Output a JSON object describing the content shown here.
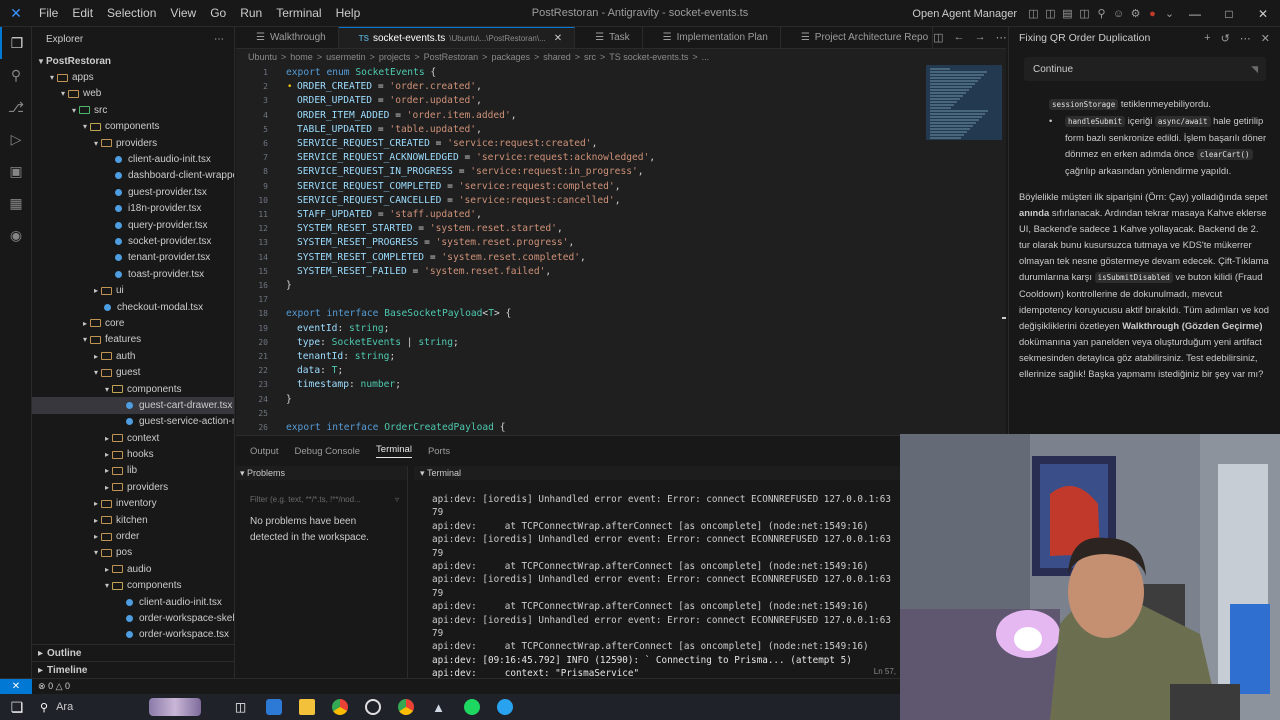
{
  "window": {
    "title": "PostRestoran - Antigravity - socket-events.ts",
    "menu": [
      "File",
      "Edit",
      "Selection",
      "View",
      "Go",
      "Run",
      "Terminal",
      "Help"
    ],
    "agent_manager": "Open Agent Manager"
  },
  "sidebar": {
    "title": "Explorer",
    "root": "PostRestoran",
    "tree": [
      {
        "label": "apps",
        "depth": 1,
        "type": "folder",
        "open": true
      },
      {
        "label": "web",
        "depth": 2,
        "type": "folder",
        "open": true
      },
      {
        "label": "src",
        "depth": 3,
        "type": "src",
        "open": true
      },
      {
        "label": "components",
        "depth": 4,
        "type": "comp",
        "open": true
      },
      {
        "label": "providers",
        "depth": 5,
        "type": "folder",
        "open": true
      },
      {
        "label": "client-audio-init.tsx",
        "depth": 6,
        "type": "file"
      },
      {
        "label": "dashboard-client-wrapper.tsx",
        "depth": 6,
        "type": "file"
      },
      {
        "label": "guest-provider.tsx",
        "depth": 6,
        "type": "file"
      },
      {
        "label": "i18n-provider.tsx",
        "depth": 6,
        "type": "file"
      },
      {
        "label": "query-provider.tsx",
        "depth": 6,
        "type": "file"
      },
      {
        "label": "socket-provider.tsx",
        "depth": 6,
        "type": "file"
      },
      {
        "label": "tenant-provider.tsx",
        "depth": 6,
        "type": "file"
      },
      {
        "label": "toast-provider.tsx",
        "depth": 6,
        "type": "file"
      },
      {
        "label": "ui",
        "depth": 5,
        "type": "folder",
        "open": false
      },
      {
        "label": "checkout-modal.tsx",
        "depth": 5,
        "type": "file"
      },
      {
        "label": "core",
        "depth": 4,
        "type": "folder",
        "open": false
      },
      {
        "label": "features",
        "depth": 4,
        "type": "folder",
        "open": true
      },
      {
        "label": "auth",
        "depth": 5,
        "type": "folder",
        "open": false
      },
      {
        "label": "guest",
        "depth": 5,
        "type": "folder",
        "open": true
      },
      {
        "label": "components",
        "depth": 6,
        "type": "comp",
        "open": true
      },
      {
        "label": "guest-cart-drawer.tsx",
        "depth": 7,
        "type": "file",
        "selected": true
      },
      {
        "label": "guest-service-action-menu.t...",
        "depth": 7,
        "type": "file"
      },
      {
        "label": "context",
        "depth": 6,
        "type": "folder",
        "open": false
      },
      {
        "label": "hooks",
        "depth": 6,
        "type": "folder",
        "open": false
      },
      {
        "label": "lib",
        "depth": 6,
        "type": "folder",
        "open": false
      },
      {
        "label": "providers",
        "depth": 6,
        "type": "folder",
        "open": false
      },
      {
        "label": "inventory",
        "depth": 5,
        "type": "folder",
        "open": false
      },
      {
        "label": "kitchen",
        "depth": 5,
        "type": "folder",
        "open": false
      },
      {
        "label": "order",
        "depth": 5,
        "type": "folder",
        "open": false
      },
      {
        "label": "pos",
        "depth": 5,
        "type": "folder",
        "open": true
      },
      {
        "label": "audio",
        "depth": 6,
        "type": "folder",
        "open": false
      },
      {
        "label": "components",
        "depth": 6,
        "type": "comp",
        "open": true
      },
      {
        "label": "client-audio-init.tsx",
        "depth": 7,
        "type": "file"
      },
      {
        "label": "order-workspace-skeleton.tsx",
        "depth": 7,
        "type": "file"
      },
      {
        "label": "order-workspace.tsx",
        "depth": 7,
        "type": "file"
      }
    ],
    "outline": "Outline",
    "timeline": "Timeline"
  },
  "tabs": [
    {
      "label": "Walkthrough",
      "active": false
    },
    {
      "label": "socket-events.ts",
      "path": "\\Ubuntu\\...\\PostRestoran\\...",
      "active": true
    },
    {
      "label": "Task",
      "active": false
    },
    {
      "label": "Implementation Plan",
      "active": false
    },
    {
      "label": "Project Architecture Repo",
      "active": false
    }
  ],
  "breadcrumb": [
    "Ubuntu",
    ">",
    "home",
    ">",
    "usermetin",
    ">",
    "projects",
    ">",
    "PostRestoran",
    ">",
    "packages",
    ">",
    "shared",
    ">",
    "src",
    ">",
    "TS socket-events.ts",
    ">",
    "..."
  ],
  "editor": {
    "lines": [
      [
        [
          "kw",
          "export "
        ],
        [
          "kw",
          "enum "
        ],
        [
          "ty",
          "SocketEvents "
        ],
        [
          "pn",
          "{"
        ]
      ],
      [
        [
          "en",
          "ORDER_CREATED"
        ],
        [
          "pn",
          " = "
        ],
        [
          "str",
          "'order.created'"
        ],
        [
          "pn",
          ","
        ]
      ],
      [
        [
          "en",
          "ORDER_UPDATED"
        ],
        [
          "pn",
          " = "
        ],
        [
          "str",
          "'order.updated'"
        ],
        [
          "pn",
          ","
        ]
      ],
      [
        [
          "en",
          "ORDER_ITEM_ADDED"
        ],
        [
          "pn",
          " = "
        ],
        [
          "str",
          "'order.item.added'"
        ],
        [
          "pn",
          ","
        ]
      ],
      [
        [
          "en",
          "TABLE_UPDATED"
        ],
        [
          "pn",
          " = "
        ],
        [
          "str",
          "'table.updated'"
        ],
        [
          "pn",
          ","
        ]
      ],
      [
        [
          "en",
          "SERVICE_REQUEST_CREATED"
        ],
        [
          "pn",
          " = "
        ],
        [
          "str",
          "'service:request:created'"
        ],
        [
          "pn",
          ","
        ]
      ],
      [
        [
          "en",
          "SERVICE_REQUEST_ACKNOWLEDGED"
        ],
        [
          "pn",
          " = "
        ],
        [
          "str",
          "'service:request:acknowledged'"
        ],
        [
          "pn",
          ","
        ]
      ],
      [
        [
          "en",
          "SERVICE_REQUEST_IN_PROGRESS"
        ],
        [
          "pn",
          " = "
        ],
        [
          "str",
          "'service:request:in_progress'"
        ],
        [
          "pn",
          ","
        ]
      ],
      [
        [
          "en",
          "SERVICE_REQUEST_COMPLETED"
        ],
        [
          "pn",
          " = "
        ],
        [
          "str",
          "'service:request:completed'"
        ],
        [
          "pn",
          ","
        ]
      ],
      [
        [
          "en",
          "SERVICE_REQUEST_CANCELLED"
        ],
        [
          "pn",
          " = "
        ],
        [
          "str",
          "'service:request:cancelled'"
        ],
        [
          "pn",
          ","
        ]
      ],
      [
        [
          "en",
          "STAFF_UPDATED"
        ],
        [
          "pn",
          " = "
        ],
        [
          "str",
          "'staff.updated'"
        ],
        [
          "pn",
          ","
        ]
      ],
      [
        [
          "en",
          "SYSTEM_RESET_STARTED"
        ],
        [
          "pn",
          " = "
        ],
        [
          "str",
          "'system.reset.started'"
        ],
        [
          "pn",
          ","
        ]
      ],
      [
        [
          "en",
          "SYSTEM_RESET_PROGRESS"
        ],
        [
          "pn",
          " = "
        ],
        [
          "str",
          "'system.reset.progress'"
        ],
        [
          "pn",
          ","
        ]
      ],
      [
        [
          "en",
          "SYSTEM_RESET_COMPLETED"
        ],
        [
          "pn",
          " = "
        ],
        [
          "str",
          "'system.reset.completed'"
        ],
        [
          "pn",
          ","
        ]
      ],
      [
        [
          "en",
          "SYSTEM_RESET_FAILED"
        ],
        [
          "pn",
          " = "
        ],
        [
          "str",
          "'system.reset.failed'"
        ],
        [
          "pn",
          ","
        ]
      ],
      [
        [
          "pn",
          "}"
        ]
      ],
      [],
      [
        [
          "kw",
          "export "
        ],
        [
          "kw",
          "interface "
        ],
        [
          "ty",
          "BaseSocketPayload"
        ],
        [
          "pn",
          "<"
        ],
        [
          "tp",
          "T"
        ],
        [
          "pn",
          "> {"
        ]
      ],
      [
        [
          "en",
          "eventId"
        ],
        [
          "pn",
          ": "
        ],
        [
          "ty",
          "string"
        ],
        [
          "pn",
          ";"
        ]
      ],
      [
        [
          "en",
          "type"
        ],
        [
          "pn",
          ": "
        ],
        [
          "ty",
          "SocketEvents"
        ],
        [
          "pn",
          " | "
        ],
        [
          "ty",
          "string"
        ],
        [
          "pn",
          ";"
        ]
      ],
      [
        [
          "en",
          "tenantId"
        ],
        [
          "pn",
          ": "
        ],
        [
          "ty",
          "string"
        ],
        [
          "pn",
          ";"
        ]
      ],
      [
        [
          "en",
          "data"
        ],
        [
          "pn",
          ": "
        ],
        [
          "tp",
          "T"
        ],
        [
          "pn",
          ";"
        ]
      ],
      [
        [
          "en",
          "timestamp"
        ],
        [
          "pn",
          ": "
        ],
        [
          "ty",
          "number"
        ],
        [
          "pn",
          ";"
        ]
      ],
      [
        [
          "pn",
          "}"
        ]
      ],
      [],
      [
        [
          "kw",
          "export "
        ],
        [
          "kw",
          "interface "
        ],
        [
          "ty",
          "OrderCreatedPayload "
        ],
        [
          "pn",
          "{"
        ]
      ]
    ]
  },
  "panel": {
    "tabs": [
      "Output",
      "Debug Console",
      "Terminal",
      "Ports"
    ],
    "active_tab": "Terminal",
    "problems_title": "Problems",
    "filter_placeholder": "Filter (e.g. text, **/*.ts, !**/nod...",
    "no_problems": "No problems have been detected in the workspace.",
    "terminal_title": "Terminal",
    "terminal_lines": [
      "api:dev: [ioredis] Unhandled error event: Error: connect ECONNREFUSED 127.0.0.1:63",
      "79",
      "api:dev:     at TCPConnectWrap.afterConnect [as oncomplete] (node:net:1549:16)",
      "api:dev: [ioredis] Unhandled error event: Error: connect ECONNREFUSED 127.0.0.1:63",
      "79",
      "api:dev:     at TCPConnectWrap.afterConnect [as oncomplete] (node:net:1549:16)",
      "api:dev: [ioredis] Unhandled error event: Error: connect ECONNREFUSED 127.0.0.1:63",
      "79",
      "api:dev:     at TCPConnectWrap.afterConnect [as oncomplete] (node:net:1549:16)",
      "api:dev: [ioredis] Unhandled error event: Error: connect ECONNREFUSED 127.0.0.1:63",
      "79",
      "api:dev:     at TCPConnectWrap.afterConnect [as oncomplete] (node:net:1549:16)",
      "api:dev: [09:16:45.792] INFO (12590): ` Connecting to Prisma... (attempt 5)",
      "api:dev:     context: \"PrismaService\""
    ],
    "cursor_pos": "Ln 57,"
  },
  "chat": {
    "title": "Fixing QR Order Duplication",
    "continue_label": "Continue",
    "bullet1_pre": "sessionStorage",
    "bullet1_post": " tetiklenmeyebiliyordu.",
    "bullet2_code1": "handleSubmit",
    "bullet2_mid": " içeriği ",
    "bullet2_code2": "async/await",
    "bullet2_text": " hale getirilip form bazlı senkronize edildi. İşlem başarılı döner dönmez en erken adımda önce ",
    "bullet2_code3": "clearCart()",
    "bullet2_end": " çağrılıp arkasından yönlendirme yapıldı.",
    "para1": "Böylelikle müşteri ilk siparişini (Örn: Çay) yolladığında sepet ",
    "para1_bold": "anında",
    "para1_b": " sıfırlanacak. Ardından tekrar masaya Kahve eklerse UI, Backend'e sadece 1 Kahve yollayacak. Backend de 2. tur olarak bunu kusursuzca tutmaya ve KDS'te mükerrer olmayan tek nesne göstermeye devam edecek. Çift-Tıklama durumlarına karşı ",
    "para1_code": "isSubmitDisabled",
    "para1_c": " ve buton kilidi (Fraud Cooldown) kontrollerine de dokunulmadı, mevcut idempotency koruyucusu aktif bırakıldı. Tüm adımları ve kod değişikliklerini özetleyen ",
    "para1_bold2": "Walkthrough (Gözden Geçirme)",
    "para1_d": " dokümanına yan panelden veya oluşturduğum yeni artifact sekmesinden detaylıca göz atabilirsiniz. Test edebilirsiniz, ellerinize sağlık! Başka yapmamı istediğiniz bir şey var mı?"
  },
  "status": {
    "errors": "0",
    "warnings": "0"
  },
  "taskbar": {
    "search_label": "Ara"
  },
  "colors": {
    "accent": "#0078d4",
    "editor_bg": "#1f1f1f",
    "chrome_bg": "#181818"
  }
}
